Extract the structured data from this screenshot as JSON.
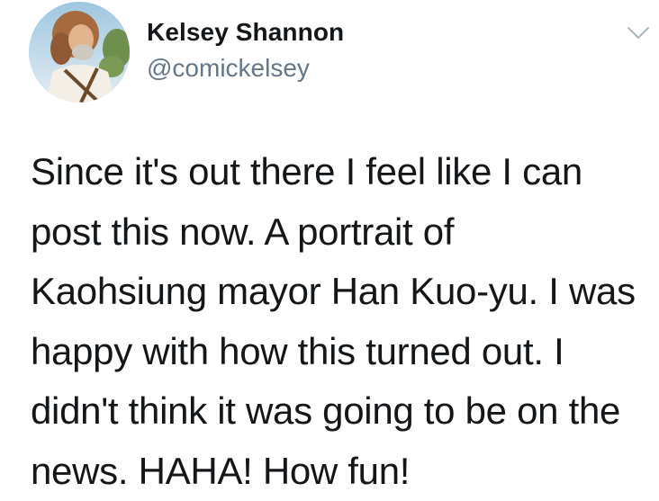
{
  "user": {
    "display_name": "Kelsey Shannon",
    "handle": "@comickelsey",
    "avatar_icon": "profile-photo",
    "menu_icon": "chevron-down-icon"
  },
  "tweet": {
    "lines": [
      "Since it's out there I feel like I can",
      "post this now. A portrait of",
      "Kaohsiung mayor Han Kuo-yu. I was",
      "happy with how this turned out. I",
      "didn't think it was going to be on the",
      "news. HAHA! How fun!"
    ]
  },
  "colors": {
    "text": "#14171a",
    "secondary_text": "#657786",
    "caret": "#aab8c2",
    "background": "#ffffff"
  }
}
